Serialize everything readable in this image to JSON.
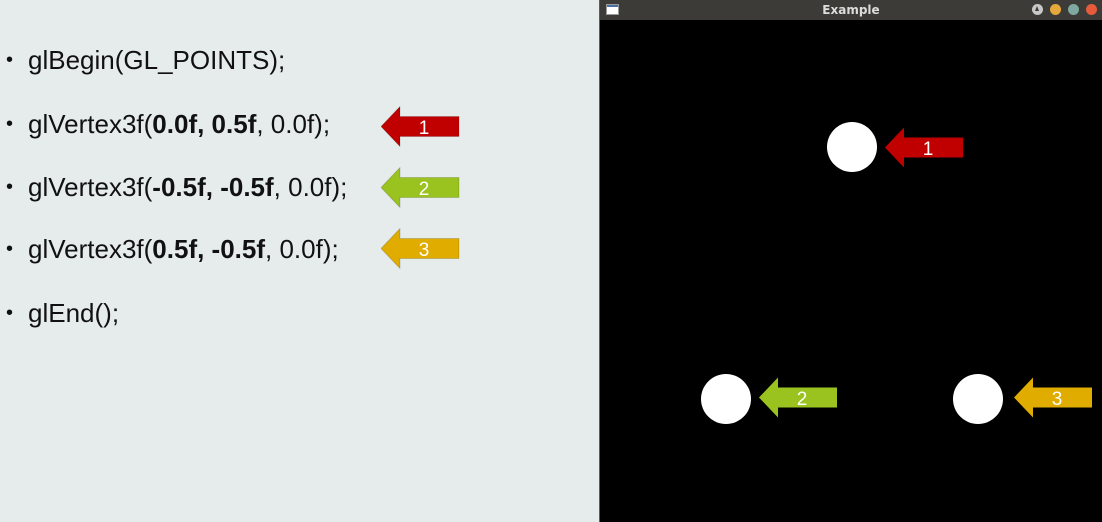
{
  "slide": {
    "bullet_glyph": "•",
    "lines": {
      "begin": {
        "text": "glBegin(GL_POINTS);"
      },
      "v1": {
        "pre": "glVertex3f(",
        "bold": "0.0f, 0.5f",
        "post": ", 0.0f);"
      },
      "v2": {
        "pre": "glVertex3f(",
        "bold": "-0.5f, -0.5f",
        "post": ", 0.0f);"
      },
      "v3": {
        "pre": "glVertex3f(",
        "bold": "0.5f, -0.5f",
        "post": ", 0.0f);"
      },
      "end": {
        "text": "glEnd();"
      }
    },
    "arrows": {
      "a1": {
        "label": "1",
        "color": "#c00000"
      },
      "a2": {
        "label": "2",
        "color": "#9ac31f"
      },
      "a3": {
        "label": "3",
        "color": "#e0ac00"
      }
    }
  },
  "window": {
    "title": "Example",
    "background": "#000000",
    "point_color": "#ffffff",
    "arrows": {
      "a1": {
        "label": "1",
        "color": "#c00000"
      },
      "a2": {
        "label": "2",
        "color": "#9ac31f"
      },
      "a3": {
        "label": "3",
        "color": "#e0ac00"
      }
    },
    "controls": {
      "up_icon": "arrow-up-icon",
      "minimize_color": "#e5a83b",
      "maximize_color": "#7fa9a0",
      "close_color": "#e65b3c"
    }
  }
}
